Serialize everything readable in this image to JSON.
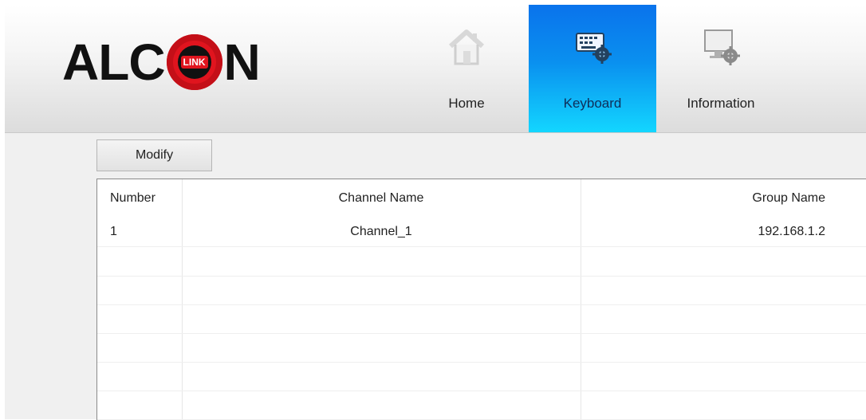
{
  "brand": {
    "logo_text_left": "ALC",
    "logo_badge": "LINK",
    "logo_text_right": "N"
  },
  "nav": {
    "items": [
      {
        "label": "Home",
        "icon": "home-icon",
        "active": false
      },
      {
        "label": "Keyboard",
        "icon": "keyboard-settings-icon",
        "active": true
      },
      {
        "label": "Information",
        "icon": "monitor-settings-icon",
        "active": false
      }
    ]
  },
  "toolbar": {
    "modify_label": "Modify"
  },
  "table": {
    "columns": [
      "Number",
      "Channel Name",
      "Group Name"
    ],
    "rows": [
      {
        "number": "1",
        "channel_name": "Channel_1",
        "group_name": "192.168.1.2"
      }
    ]
  },
  "colors": {
    "active_tab_top": "#0a73ec",
    "active_tab_bottom": "#13d6ff",
    "logo_red": "#e0141e"
  }
}
